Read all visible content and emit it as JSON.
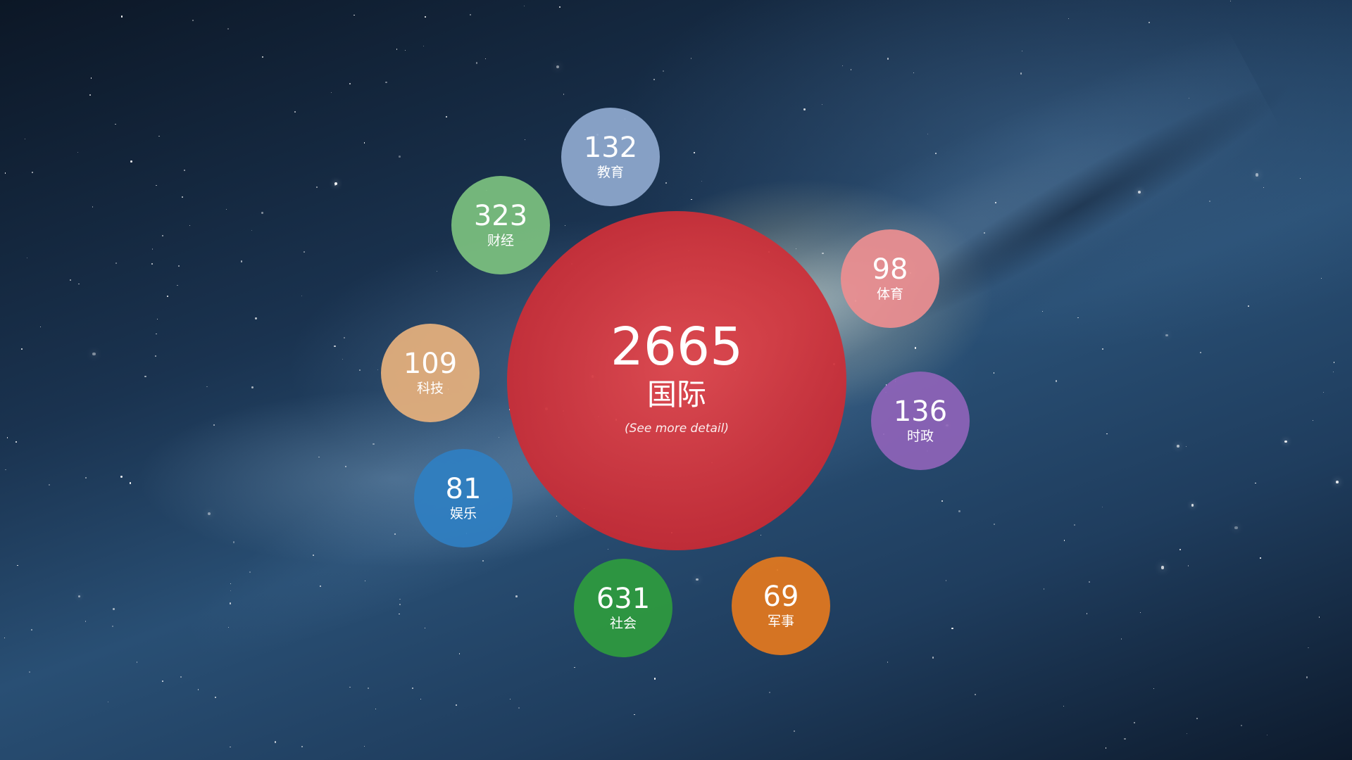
{
  "center": {
    "value": "2665",
    "label": "国际",
    "detail": "(See more detail)",
    "color": "#d9383f"
  },
  "categories": [
    {
      "value": "132",
      "label": "教育",
      "color": "#8fa9cf"
    },
    {
      "value": "323",
      "label": "财经",
      "color": "#7cc17f"
    },
    {
      "value": "98",
      "label": "体育",
      "color": "#ec8e90"
    },
    {
      "value": "109",
      "label": "科技",
      "color": "#e6b07d"
    },
    {
      "value": "136",
      "label": "时政",
      "color": "#8e63b8"
    },
    {
      "value": "81",
      "label": "娱乐",
      "color": "#2f7fc2"
    },
    {
      "value": "631",
      "label": "社会",
      "color": "#2e9b3e"
    },
    {
      "value": "69",
      "label": "军事",
      "color": "#e3781e"
    }
  ]
}
